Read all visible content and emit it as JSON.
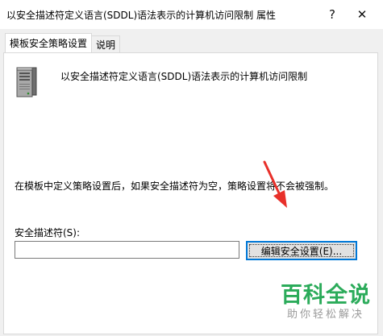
{
  "window": {
    "title": "以安全描述符定义语言(SDDL)语法表示的计算机访问限制 属性",
    "help_label": "?",
    "close_label": "✕"
  },
  "tabs": [
    {
      "label": "模板安全策略设置",
      "active": true
    },
    {
      "label": "说明",
      "active": false
    }
  ],
  "policy": {
    "icon": "server-icon",
    "title": "以安全描述符定义语言(SDDL)语法表示的计算机访问限制",
    "description": "在模板中定义策略设置后，如果安全描述符为空，策略设置将不会被强制。"
  },
  "security_descriptor": {
    "label": "安全描述符(S):",
    "value": "",
    "placeholder": ""
  },
  "buttons": {
    "edit_security": "编辑安全设置(E)..."
  },
  "watermark": {
    "main": "百科全说",
    "sub": "助你轻松解决"
  },
  "colors": {
    "accent": "#0078d7",
    "annotation_arrow": "#e8302a",
    "watermark_green": "#2bab5a"
  }
}
